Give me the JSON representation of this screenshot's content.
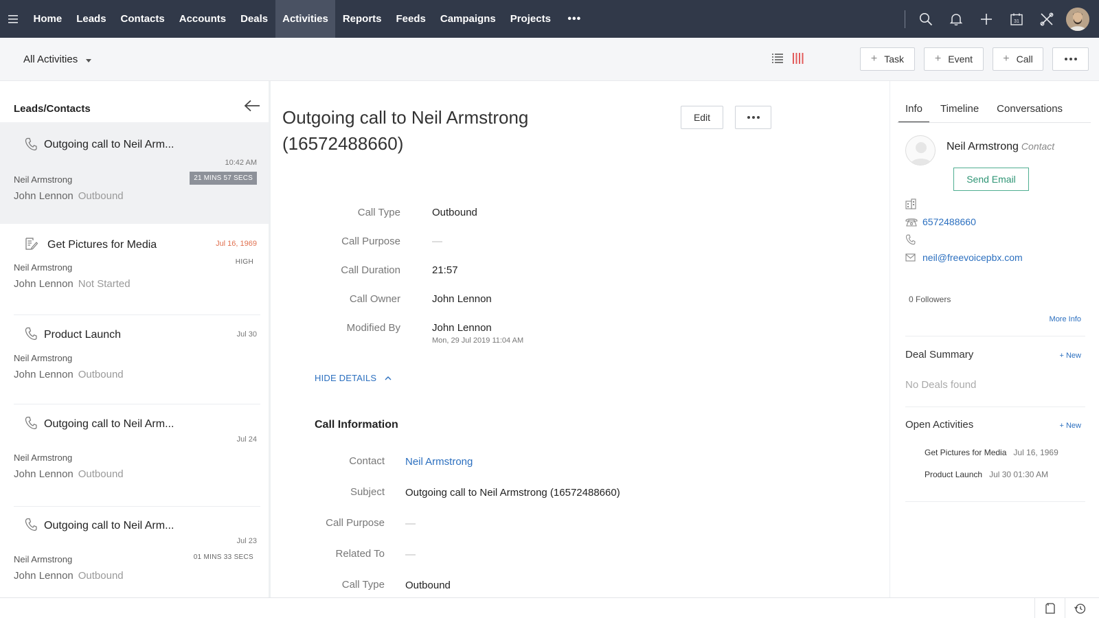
{
  "nav": {
    "items": [
      {
        "label": "Home"
      },
      {
        "label": "Leads"
      },
      {
        "label": "Contacts"
      },
      {
        "label": "Accounts"
      },
      {
        "label": "Deals"
      },
      {
        "label": "Activities",
        "active": true
      },
      {
        "label": "Reports"
      },
      {
        "label": "Feeds"
      },
      {
        "label": "Campaigns"
      },
      {
        "label": "Projects"
      }
    ],
    "more_label": "•••",
    "icons": [
      "search-icon",
      "bell-icon",
      "plus-icon",
      "calendar-icon",
      "tools-icon"
    ],
    "calendar_day": "31",
    "bg_color": "#313949",
    "active_color": "#4a5263"
  },
  "toolbar": {
    "filter_label": "All Activities",
    "task_label": "Task",
    "event_label": "Event",
    "call_label": "Call",
    "plus": "+"
  },
  "left": {
    "heading": "Leads/Contacts",
    "items": [
      {
        "icon": "phone-icon",
        "title": "Outgoing call to Neil Arm...",
        "time": "10:42 AM",
        "badge": "21 MINS 57 SECS",
        "who": "Neil Armstrong",
        "owner": "John Lennon",
        "status": "Outbound",
        "selected": true
      },
      {
        "icon": "task-icon",
        "title": "Get Pictures for Media",
        "time": "Jul 16, 1969",
        "badge": "HIGH",
        "who": "Neil Armstrong",
        "owner": "John Lennon",
        "status": "Not Started"
      },
      {
        "icon": "phone-icon",
        "title": "Product Launch",
        "time": "Jul 30",
        "who": "Neil Armstrong",
        "owner": "John Lennon",
        "status": "Outbound"
      },
      {
        "icon": "phone-icon",
        "title": "Outgoing call to Neil Arm...",
        "time": "Jul 24",
        "who": "Neil Armstrong",
        "owner": "John Lennon",
        "status": "Outbound"
      },
      {
        "icon": "phone-icon",
        "title": "Outgoing call to Neil Arm...",
        "time": "Jul 23",
        "badge": "01 MINS 33 SECS",
        "who": "Neil Armstrong",
        "owner": "John Lennon",
        "status": "Outbound"
      }
    ]
  },
  "detail": {
    "title": "Outgoing call to Neil Armstrong (16572488660)",
    "edit_label": "Edit",
    "fields": [
      {
        "label": "Call Type",
        "value": "Outbound"
      },
      {
        "label": "Call Purpose",
        "value": "—"
      },
      {
        "label": "Call Duration",
        "value": "21:57"
      },
      {
        "label": "Call Owner",
        "value": "John Lennon"
      },
      {
        "label": "Modified By",
        "value": "John Lennon",
        "sub": "Mon, 29 Jul 2019 11:04 AM"
      }
    ],
    "hide_details_label": "HIDE DETAILS",
    "section_title": "Call Information",
    "info_fields": [
      {
        "label": "Contact",
        "value": "Neil Armstrong",
        "link": true
      },
      {
        "label": "Subject",
        "value": "Outgoing call to Neil Armstrong (16572488660)"
      },
      {
        "label": "Call Purpose",
        "value": "—"
      },
      {
        "label": "Related To",
        "value": "—"
      },
      {
        "label": "Call Type",
        "value": "Outbound"
      }
    ]
  },
  "right": {
    "tabs": [
      {
        "label": "Info",
        "active": true
      },
      {
        "label": "Timeline"
      },
      {
        "label": "Conversations"
      }
    ],
    "contact_name": "Neil Armstrong",
    "contact_type": "Contact",
    "send_email_label": "Send Email",
    "phone": "6572488660",
    "email": "neil@freevoicepbx.com",
    "followers": "0 Followers",
    "more_info": "More Info",
    "deal_summary_title": "Deal Summary",
    "new_label": "+ New",
    "no_deals": "No Deals found",
    "open_activities_title": "Open Activities",
    "open_activities": [
      {
        "title": "Get Pictures for Media",
        "date": "Jul 16, 1969"
      },
      {
        "title": "Product Launch",
        "date": "Jul 30 01:30 AM"
      }
    ]
  },
  "colors": {
    "link": "#2b6fbf",
    "accent_green": "#2f9575",
    "high_date": "#e0704f",
    "kanban_red": "#e25a5a"
  }
}
